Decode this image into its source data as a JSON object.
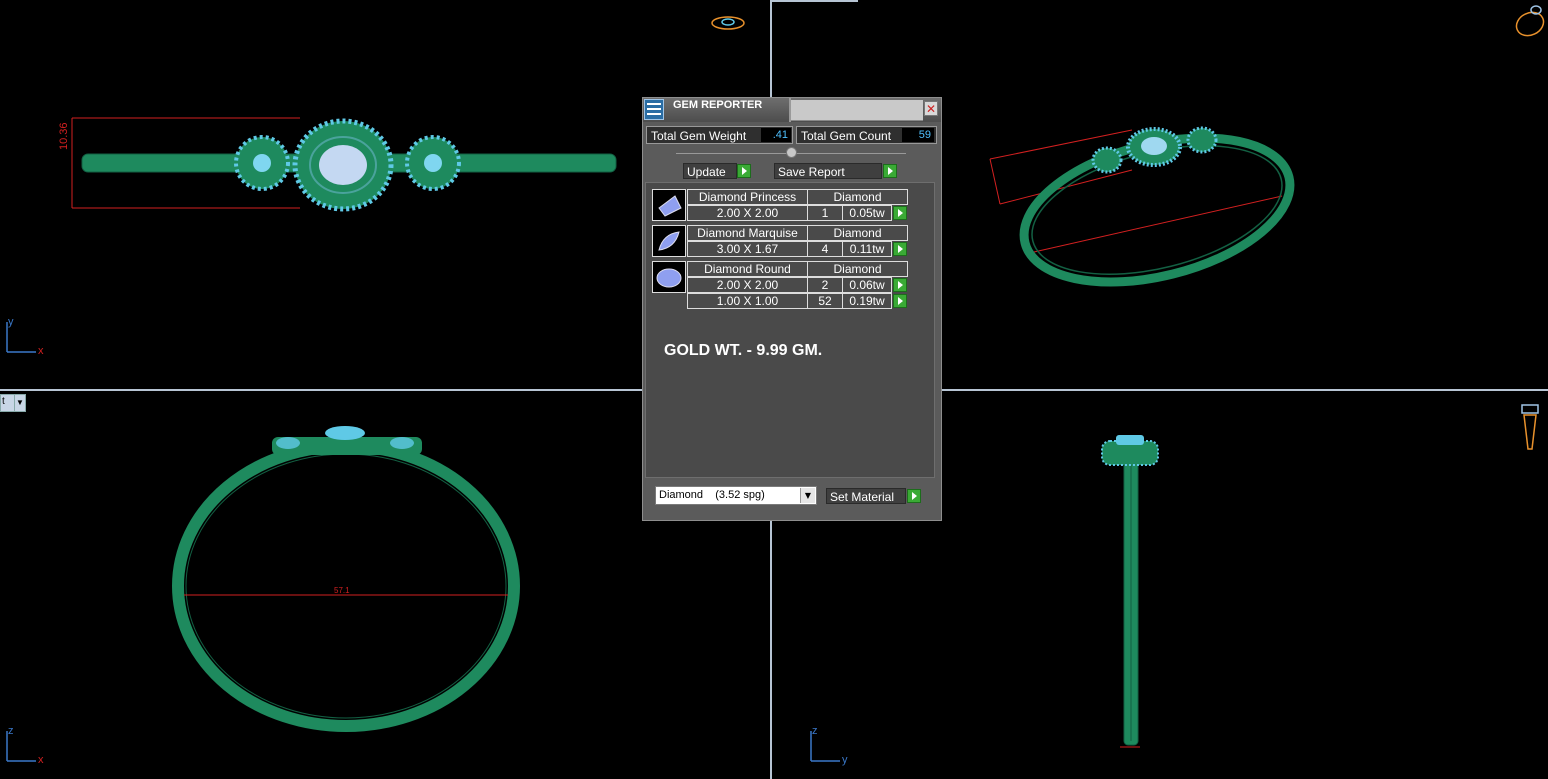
{
  "dialog": {
    "title": "GEM REPORTER",
    "close_icon": "close-icon",
    "total_weight_label": "Total Gem Weight",
    "total_weight_value": ".41",
    "total_count_label": "Total Gem Count",
    "total_count_value": "59",
    "update_label": "Update",
    "save_report_label": "Save Report",
    "gems": [
      {
        "name": "Diamond Princess",
        "material": "Diamond",
        "rows": [
          {
            "size": "2.00 X 2.00",
            "count": "1",
            "weight": "0.05tw"
          }
        ]
      },
      {
        "name": "Diamond Marquise",
        "material": "Diamond",
        "rows": [
          {
            "size": "3.00 X 1.67",
            "count": "4",
            "weight": "0.11tw"
          }
        ]
      },
      {
        "name": "Diamond Round",
        "material": "Diamond",
        "rows": [
          {
            "size": "2.00 X 2.00",
            "count": "2",
            "weight": "0.06tw"
          },
          {
            "size": "1.00 X 1.00",
            "count": "52",
            "weight": "0.19tw"
          }
        ]
      }
    ],
    "note": "GOLD WT. - 9.99 GM.",
    "material_select": "Diamond    (3.52 spg)",
    "set_material_label": "Set Material"
  },
  "viewports": {
    "top_left": {
      "axis_v": "y",
      "axis_h": "x",
      "dimension": "10.36"
    },
    "bottom_left": {
      "axis_v": "z",
      "axis_h": "x",
      "dropdown": "t",
      "dimension": "57.1"
    },
    "bottom_right": {
      "axis_v": "z",
      "axis_h": "y"
    }
  },
  "colors": {
    "metal": "#1e8a5e",
    "gem": "#5fc9e6",
    "dimension": "#d22020",
    "viewport_divider": "#b7c5d4",
    "axis": "#3a78c9"
  }
}
